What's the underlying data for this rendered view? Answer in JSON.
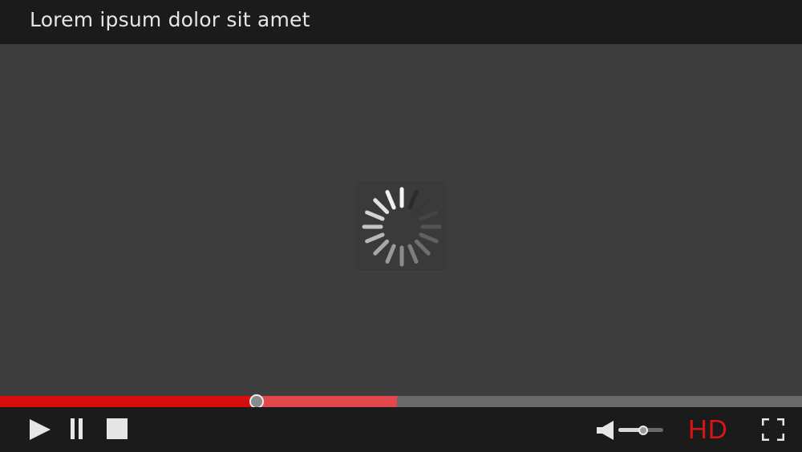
{
  "title": "Lorem ipsum dolor sit amet",
  "colors": {
    "background": "#3d3d3d",
    "bars": "#1b1b1b",
    "accent": "#d50d0d",
    "buffer": "#e2484b",
    "track": "#6a6a6a",
    "icon": "#e6e6e6"
  },
  "loading": {
    "icon": "spinner-icon"
  },
  "progress": {
    "played_fraction": 0.32,
    "buffered_fraction": 0.495
  },
  "controls": {
    "play_icon": "play-icon",
    "pause_icon": "pause-icon",
    "stop_icon": "stop-icon",
    "volume_icon": "speaker-icon",
    "volume_fraction": 0.55,
    "quality_label": "HD",
    "fullscreen_icon": "fullscreen-icon"
  }
}
